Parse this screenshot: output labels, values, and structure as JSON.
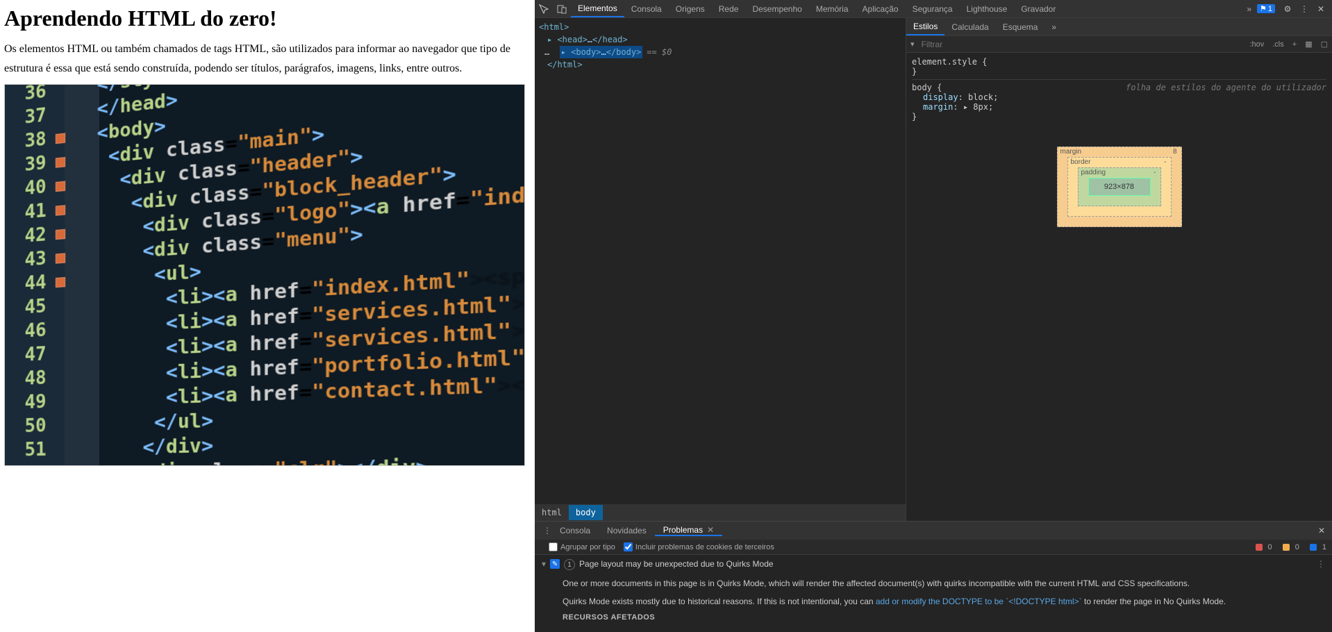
{
  "page": {
    "title": "Aprendendo HTML do zero!",
    "paragraph": "Os elementos HTML ou também chamados de tags HTML, são utilizados para informar ao navegador que tipo de estrutura é essa que está sendo construída, podendo ser títulos, parágrafos, imagens, links, entre outros.",
    "code_lines": [
      {
        "n": "36",
        "mk": "",
        "html": "<span class='ang'>&lt;/</span><span class='tag'>style</span><span class='ang'>&gt;</span>"
      },
      {
        "n": "37",
        "mk": "",
        "html": "<span class='ang'>&lt;/</span><span class='tag'>head</span><span class='ang'>&gt;</span>"
      },
      {
        "n": "38",
        "mk": "sq",
        "html": "<span class='ang'>&lt;</span><span class='tag'>body</span><span class='ang'>&gt;</span>"
      },
      {
        "n": "39",
        "mk": "sq",
        "html": " <span class='ang'>&lt;</span><span class='tag'>div</span> <span class='attr'>class</span>=<span class='str'>\"main\"</span><span class='ang'>&gt;</span>"
      },
      {
        "n": "40",
        "mk": "sq",
        "html": "  <span class='ang'>&lt;</span><span class='tag'>div</span> <span class='attr'>class</span>=<span class='str'>\"header\"</span><span class='ang'>&gt;</span>"
      },
      {
        "n": "41",
        "mk": "sq",
        "html": "   <span class='ang'>&lt;</span><span class='tag'>div</span> <span class='attr'>class</span>=<span class='str'>\"block_header\"</span><span class='ang'>&gt;</span>"
      },
      {
        "n": "42",
        "mk": "sq",
        "html": "    <span class='ang'>&lt;</span><span class='tag'>div</span> <span class='attr'>class</span>=<span class='str'>\"logo\"</span><span class='ang'>&gt;&lt;</span><span class='tag'>a</span> <span class='attr'>href</span>=<span class='str'>\"index.html\"</span><span class='dim'>&gt; ...</span>"
      },
      {
        "n": "43",
        "mk": "sq",
        "html": "    <span class='ang'>&lt;</span><span class='tag'>div</span> <span class='attr'>class</span>=<span class='str'>\"menu\"</span><span class='ang'>&gt;</span>"
      },
      {
        "n": "44",
        "mk": "sq",
        "html": "     <span class='ang'>&lt;</span><span class='tag'>ul</span><span class='ang'>&gt;</span>"
      },
      {
        "n": "45",
        "mk": "",
        "html": "      <span class='ang'>&lt;</span><span class='tag'>li</span><span class='ang'>&gt;&lt;</span><span class='tag'>a</span> <span class='attr'>href</span>=<span class='str'>\"index.html\"</span><span class='dim'>&gt;&lt;span ...</span>"
      },
      {
        "n": "46",
        "mk": "",
        "html": "      <span class='ang'>&lt;</span><span class='tag'>li</span><span class='ang'>&gt;&lt;</span><span class='tag'>a</span> <span class='attr'>href</span>=<span class='str'>\"services.html\"</span><span class='dim'>&gt;&lt;span ...</span>"
      },
      {
        "n": "47",
        "mk": "",
        "html": "      <span class='ang'>&lt;</span><span class='tag'>li</span><span class='ang'>&gt;&lt;</span><span class='tag'>a</span> <span class='attr'>href</span>=<span class='str'>\"services.html\"</span><span class='dim'>&gt;&lt;span ...</span>"
      },
      {
        "n": "48",
        "mk": "",
        "html": "      <span class='ang'>&lt;</span><span class='tag'>li</span><span class='ang'>&gt;&lt;</span><span class='tag'>a</span> <span class='attr'>href</span>=<span class='str'>\"portfolio.html\"</span><span class='dim'>&gt;&lt;span ...</span>"
      },
      {
        "n": "49",
        "mk": "",
        "html": "      <span class='ang'>&lt;</span><span class='tag'>li</span><span class='ang'>&gt;&lt;</span><span class='tag'>a</span> <span class='attr'>href</span>=<span class='str'>\"contact.html\"</span><span class='dim'>&gt;&lt;span ...</span>"
      },
      {
        "n": "50",
        "mk": "",
        "html": "     <span class='ang'>&lt;/</span><span class='tag'>ul</span><span class='ang'>&gt;</span>"
      },
      {
        "n": "51",
        "mk": "",
        "html": "    <span class='ang'>&lt;/</span><span class='tag'>div</span><span class='ang'>&gt;</span>"
      },
      {
        "n": "",
        "mk": "",
        "html": "    <span class='ang'>&lt;</span><span class='tag'>div</span> <span class='attr'>class</span>=<span class='str'>\"clr\"</span><span class='ang'>&gt;&lt;/</span><span class='tag'>div</span><span class='ang'>&gt;</span>"
      }
    ]
  },
  "devtools": {
    "tabs": [
      "Elementos",
      "Consola",
      "Origens",
      "Rede",
      "Desempenho",
      "Memória",
      "Aplicação",
      "Segurança",
      "Lighthouse",
      "Gravador"
    ],
    "active_tab": "Elementos",
    "badge": "1",
    "more_glyph": "»",
    "tree": {
      "l1": "<html>",
      "l2_open": "▸ <head>",
      "l2_mid": "…",
      "l2_close": "</head>",
      "l3_open": "▸ <body>",
      "l3_mid": "…",
      "l3_close": "</body>",
      "l3_eq": "== $0",
      "l4": "</html>"
    },
    "crumbs": [
      "html",
      "body"
    ],
    "styles": {
      "tabs": [
        "Estilos",
        "Calculada",
        "Esquema"
      ],
      "filter_placeholder": "Filtrar",
      "hov": ":hov",
      "cls": ".cls",
      "element_style": "element.style {",
      "close_brace": "}",
      "ua_label": "folha de estilos do agente do utilizador",
      "body_sel": "body {",
      "prop_display": "display",
      "val_display": "block",
      "prop_margin": "margin",
      "val_margin": "▸ 8px",
      "box_margin_label": "margin",
      "box_border_label": "border",
      "box_padding_label": "padding",
      "box_content": "923×878",
      "box_margin_value": "8",
      "box_dash": "-"
    },
    "drawer": {
      "tabs": [
        "Consola",
        "Novidades",
        "Problemas"
      ],
      "active": "Problemas",
      "group_label": "Agrupar por tipo",
      "cookies_label": "Incluir problemas de cookies de terceiros",
      "counter_red": "0",
      "counter_orange": "0",
      "counter_blue": "1",
      "issue_count": "1",
      "issue_title": "Page layout may be unexpected due to Quirks Mode",
      "issue_body1": "One or more documents in this page is in Quirks Mode, which will render the affected document(s) with quirks incompatible with the current HTML and CSS specifications.",
      "issue_body2a": "Quirks Mode exists mostly due to historical reasons. If this is not intentional, you can ",
      "issue_link": "add or modify the DOCTYPE to be `<!DOCTYPE html>`",
      "issue_body2b": " to render the page in No Quirks Mode.",
      "affected": "RECURSOS AFETADOS"
    }
  }
}
